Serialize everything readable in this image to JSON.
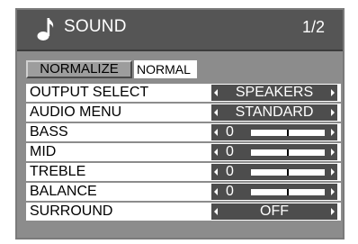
{
  "header": {
    "title": "SOUND",
    "page": "1/2"
  },
  "normalize": {
    "button_label": "NORMALIZE",
    "status": "NORMAL"
  },
  "rows": [
    {
      "label": "OUTPUT SELECT",
      "value": "SPEAKERS"
    },
    {
      "label": "AUDIO MENU",
      "value": "STANDARD"
    },
    {
      "label": "BASS",
      "value": "0",
      "level": 0.5
    },
    {
      "label": "MID",
      "value": "0",
      "level": 0.5
    },
    {
      "label": "TREBLE",
      "value": "0",
      "level": 0.5
    },
    {
      "label": "BALANCE",
      "value": "0",
      "level": 0.5
    },
    {
      "label": "SURROUND",
      "value": "OFF"
    }
  ],
  "colors": {
    "panel": "#8c8c8c",
    "header": "#555555",
    "control": "#4d4d4d"
  }
}
